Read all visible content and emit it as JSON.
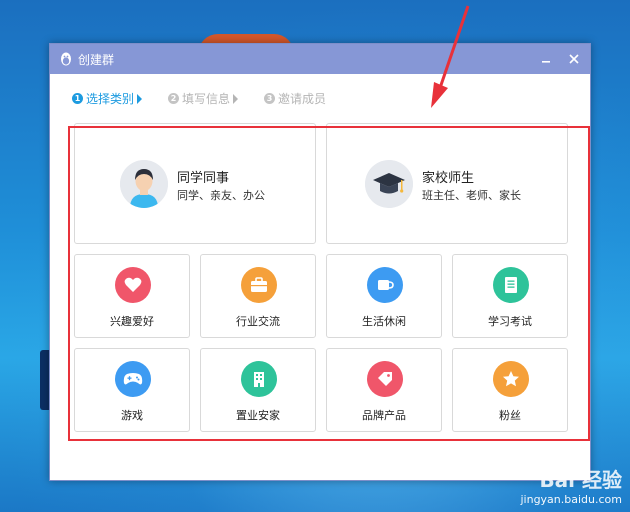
{
  "window": {
    "title": "创建群"
  },
  "steps": [
    {
      "num": "1",
      "label": "选择类别",
      "active": true
    },
    {
      "num": "2",
      "label": "填写信息",
      "active": false
    },
    {
      "num": "3",
      "label": "邀请成员",
      "active": false
    }
  ],
  "big_cards": [
    {
      "title": "同学同事",
      "subtitle": "同学、亲友、办公",
      "icon": "student-avatar-icon"
    },
    {
      "title": "家校师生",
      "subtitle": "班主任、老师、家长",
      "icon": "graduation-cap-icon"
    }
  ],
  "categories": [
    {
      "label": "兴趣爱好",
      "icon": "heart-icon",
      "color": "#f0566a"
    },
    {
      "label": "行业交流",
      "icon": "briefcase-icon",
      "color": "#f5a03a"
    },
    {
      "label": "生活休闲",
      "icon": "coffee-cup-icon",
      "color": "#3d9bf2"
    },
    {
      "label": "学习考试",
      "icon": "document-icon",
      "color": "#2ec39a"
    },
    {
      "label": "游戏",
      "icon": "gamepad-icon",
      "color": "#3d9bf2"
    },
    {
      "label": "置业安家",
      "icon": "building-icon",
      "color": "#2ec39a"
    },
    {
      "label": "品牌产品",
      "icon": "tag-icon",
      "color": "#f0566a"
    },
    {
      "label": "粉丝",
      "icon": "star-icon",
      "color": "#f5a03a"
    }
  ],
  "watermark": {
    "logo": "Bai 经验",
    "url": "jingyan.baidu.com"
  }
}
